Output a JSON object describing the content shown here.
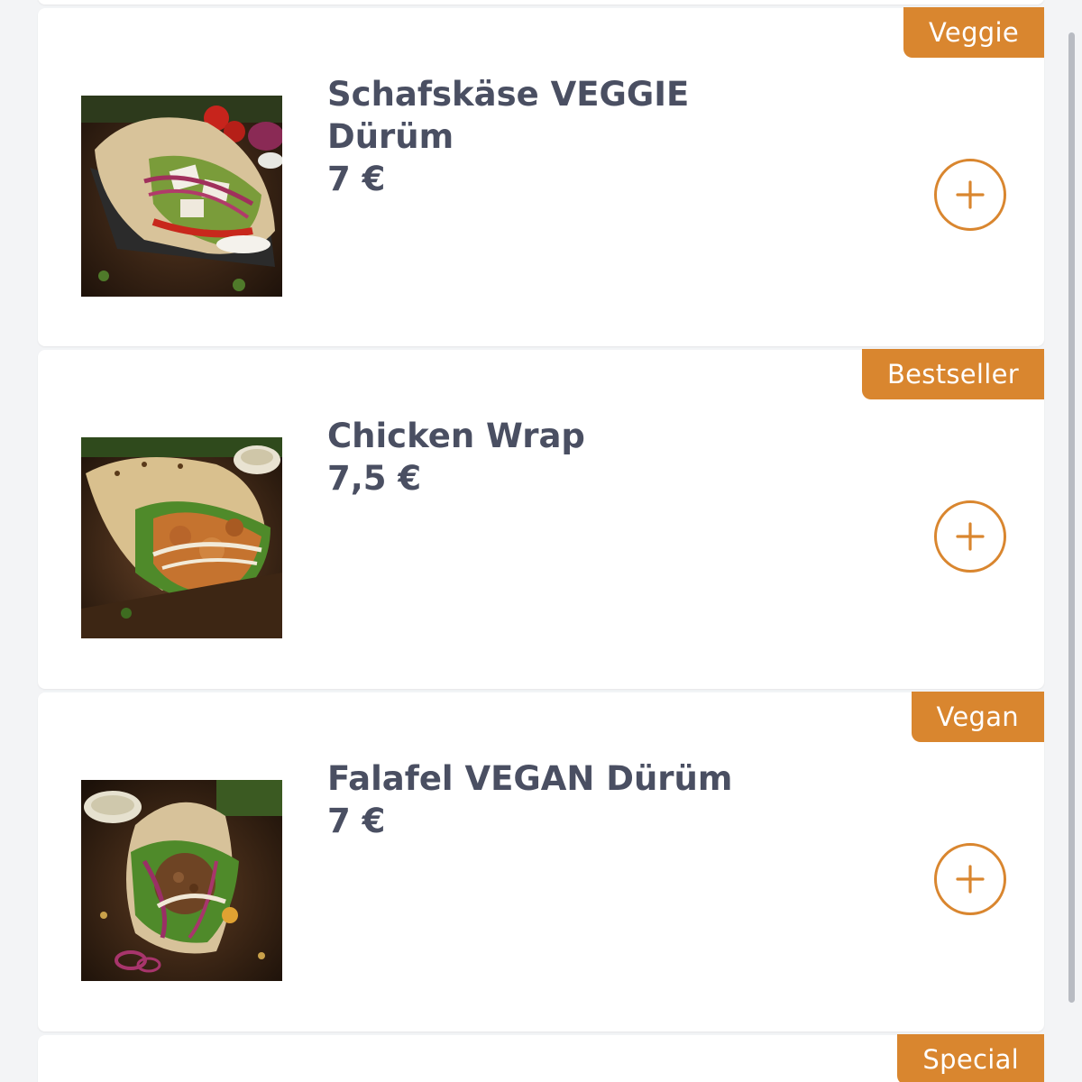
{
  "accent_color": "#d9862f",
  "text_color": "#4a4f62",
  "menu": {
    "items": [
      {
        "tag": "Veggie",
        "title_line1": "Schafskäse VEGGIE",
        "title_line2": "Dürüm",
        "price": "7 €",
        "image": "wrap-photo",
        "add_icon": "plus-icon"
      },
      {
        "tag": "Bestseller",
        "title_line1": "Chicken Wrap",
        "title_line2": "",
        "price": "7,5 €",
        "image": "wrap-photo",
        "add_icon": "plus-icon"
      },
      {
        "tag": "Vegan",
        "title_line1": "Falafel VEGAN Dürüm",
        "title_line2": "",
        "price": "7 €",
        "image": "wrap-photo",
        "add_icon": "plus-icon"
      },
      {
        "tag": "Special"
      }
    ]
  }
}
